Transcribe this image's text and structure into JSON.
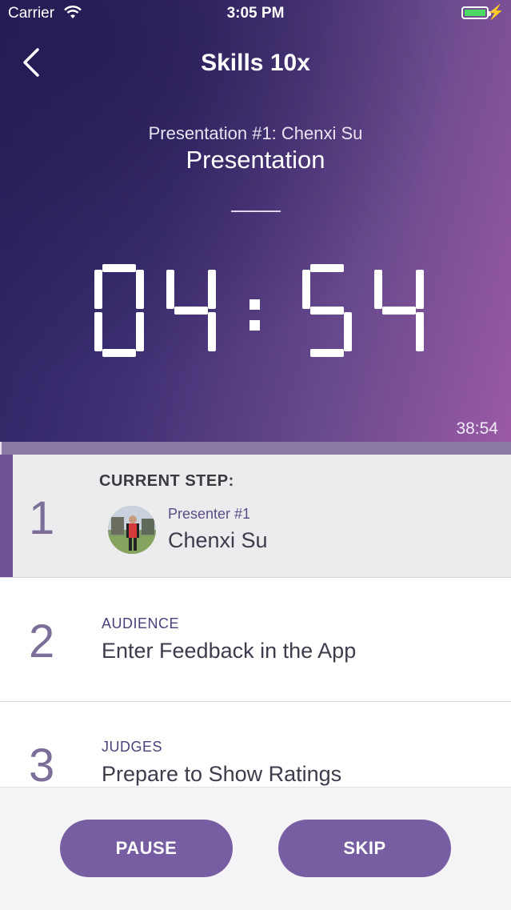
{
  "status_bar": {
    "carrier": "Carrier",
    "time": "3:05 PM"
  },
  "header": {
    "title": "Skills 10x",
    "subtitle": "Presentation #1: Chenxi Su",
    "mode": "Presentation"
  },
  "timer": {
    "display": "04:54",
    "elapsed": "38:54",
    "progress_fraction": 0.003
  },
  "steps": [
    {
      "number": "1",
      "header": "CURRENT STEP:",
      "role": "Presenter #1",
      "text": "Chenxi Su"
    },
    {
      "number": "2",
      "role": "AUDIENCE",
      "text": "Enter Feedback in the App"
    },
    {
      "number": "3",
      "role": "JUDGES",
      "text": "Prepare to Show Ratings"
    }
  ],
  "buttons": {
    "pause": "PAUSE",
    "skip": "SKIP"
  },
  "colors": {
    "accent": "#775ea3",
    "hero_start": "#2a1f5e",
    "hero_end": "#9b5aa6"
  },
  "icons": {
    "back": "chevron-left-icon",
    "wifi": "wifi-icon",
    "battery": "battery-icon",
    "charging": "bolt-icon"
  }
}
